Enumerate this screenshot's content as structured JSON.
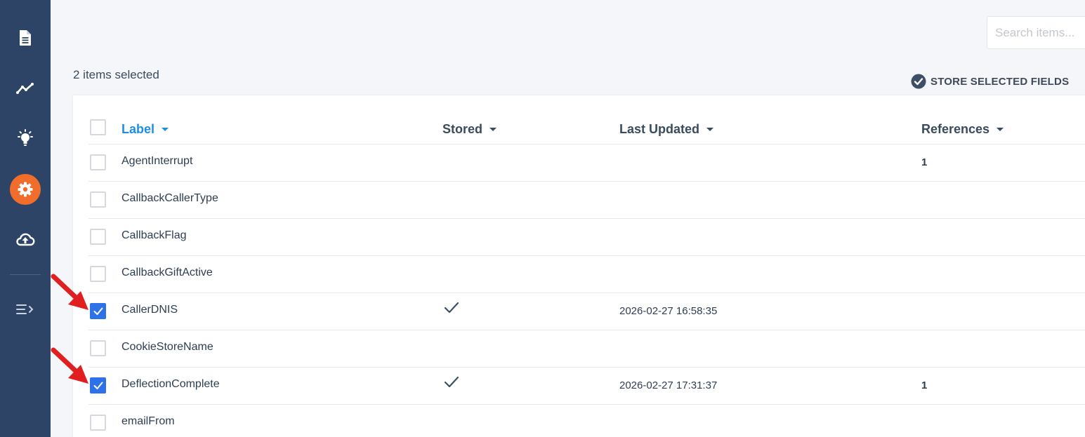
{
  "sidebar": {
    "items": [
      {
        "icon": "document-icon",
        "active": false
      },
      {
        "icon": "analytics-icon",
        "active": false
      },
      {
        "icon": "lightbulb-icon",
        "active": false
      },
      {
        "icon": "gear-icon",
        "active": true
      },
      {
        "icon": "cloud-upload-icon",
        "active": false
      },
      {
        "icon": "expand-menu-icon",
        "active": false
      }
    ]
  },
  "search": {
    "placeholder": "Search items...",
    "value": ""
  },
  "selection": {
    "count_text": "2 items selected"
  },
  "toolbar": {
    "store_label": "STORE SELECTED FIELDS"
  },
  "table": {
    "columns": {
      "label": "Label",
      "stored": "Stored",
      "last_updated": "Last Updated",
      "references": "References"
    },
    "sorted_column": "label",
    "rows": [
      {
        "label": "AgentInterrupt",
        "checked": false,
        "stored": false,
        "last_updated": "",
        "references": "1"
      },
      {
        "label": "CallbackCallerType",
        "checked": false,
        "stored": false,
        "last_updated": "",
        "references": ""
      },
      {
        "label": "CallbackFlag",
        "checked": false,
        "stored": false,
        "last_updated": "",
        "references": ""
      },
      {
        "label": "CallbackGiftActive",
        "checked": false,
        "stored": false,
        "last_updated": "",
        "references": ""
      },
      {
        "label": "CallerDNIS",
        "checked": true,
        "stored": true,
        "last_updated": "2026-02-27 16:58:35",
        "references": ""
      },
      {
        "label": "CookieStoreName",
        "checked": false,
        "stored": false,
        "last_updated": "",
        "references": ""
      },
      {
        "label": "DeflectionComplete",
        "checked": true,
        "stored": true,
        "last_updated": "2026-02-27 17:31:37",
        "references": "1"
      },
      {
        "label": "emailFrom",
        "checked": false,
        "stored": false,
        "last_updated": "",
        "references": ""
      }
    ]
  },
  "colors": {
    "sidebar_bg": "#2e4466",
    "active_nav": "#f06d2b",
    "checkbox_checked": "#2e72ea",
    "sorted_header": "#1e8fe0",
    "annotation_arrow": "#e02020"
  }
}
